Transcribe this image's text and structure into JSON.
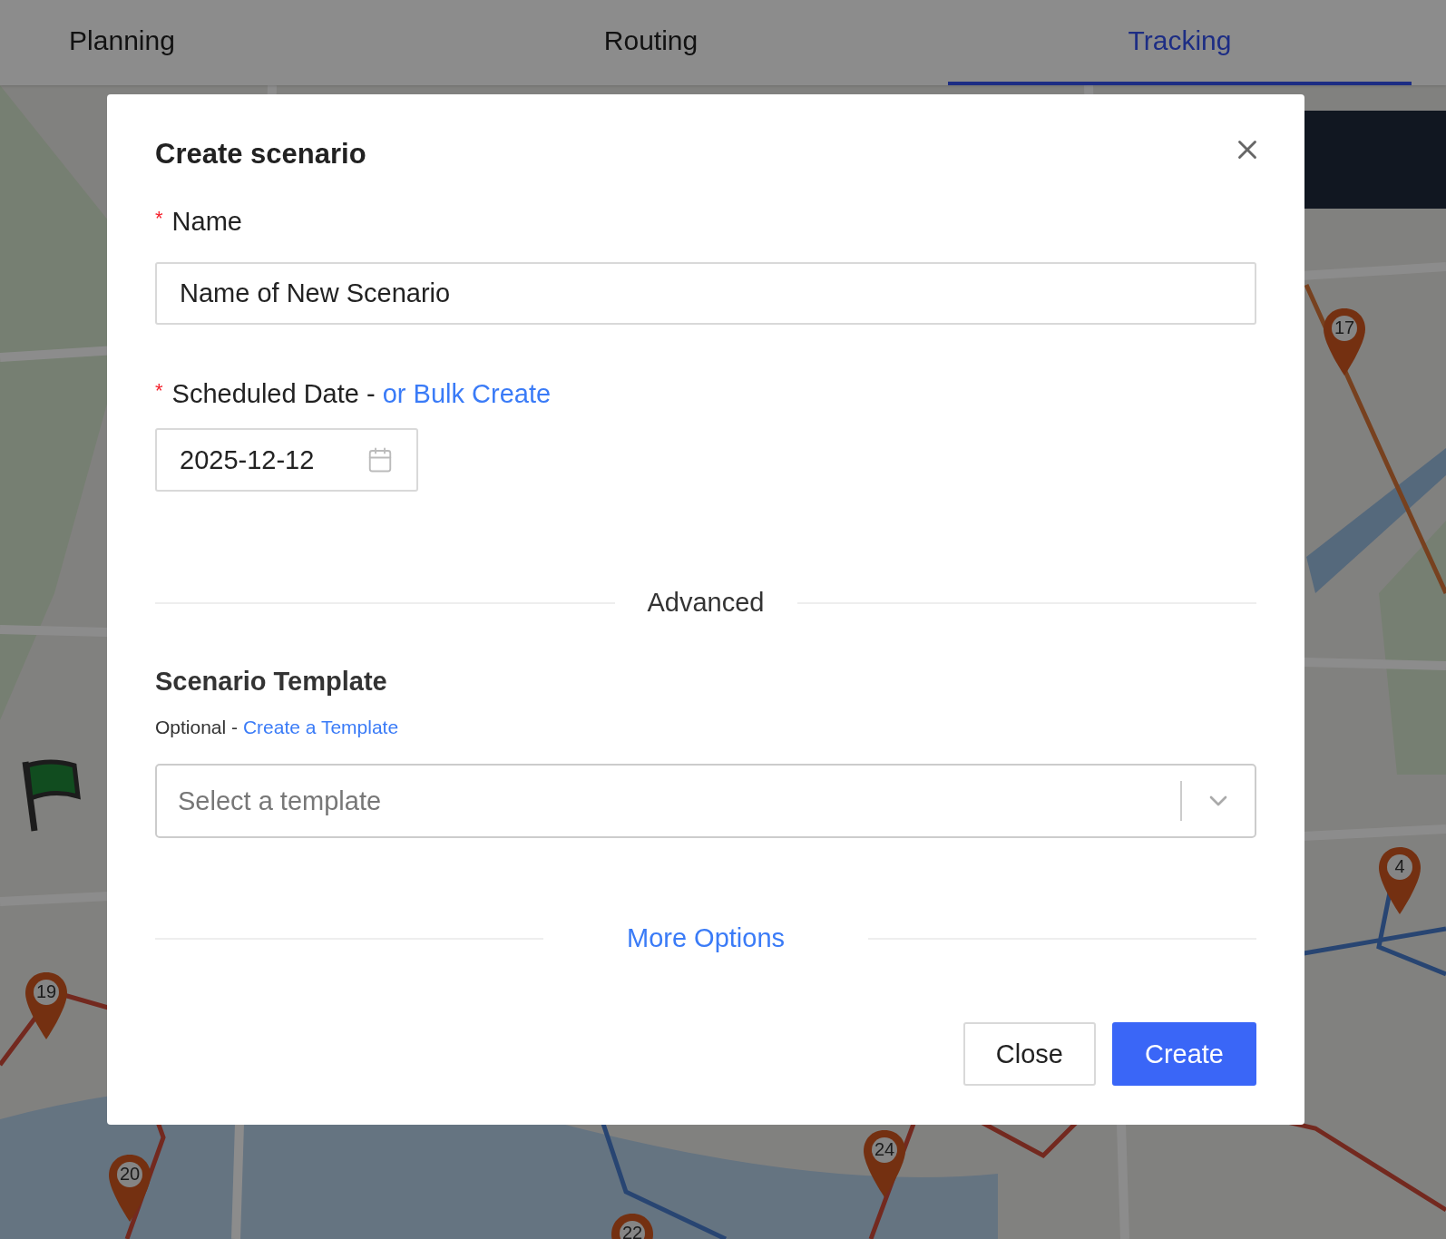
{
  "tabs": [
    {
      "label": "Planning",
      "selected": false
    },
    {
      "label": "Routing",
      "selected": false
    },
    {
      "label": "Tracking",
      "selected": true
    }
  ],
  "map": {
    "kind": "picture",
    "markers": [
      {
        "number": "17"
      },
      {
        "number": "4"
      },
      {
        "number": "19"
      },
      {
        "number": "20"
      },
      {
        "number": "24"
      },
      {
        "number": "22"
      }
    ]
  },
  "dialog": {
    "title": "Create scenario",
    "name_field": {
      "required_mark": "*",
      "label": "Name",
      "value": "Name of New Scenario"
    },
    "date_field": {
      "required_mark": "*",
      "label": "Scheduled Date - ",
      "link": "or Bulk Create",
      "value": "2025-12-12"
    },
    "advanced_divider": "Advanced",
    "template": {
      "heading": "Scenario Template",
      "hint": "Optional - ",
      "link": "Create a Template",
      "placeholder": "Select a template"
    },
    "more_options": "More Options",
    "buttons": [
      {
        "label": "Close",
        "kind": "secondary"
      },
      {
        "label": "Create",
        "kind": "primary"
      }
    ]
  }
}
